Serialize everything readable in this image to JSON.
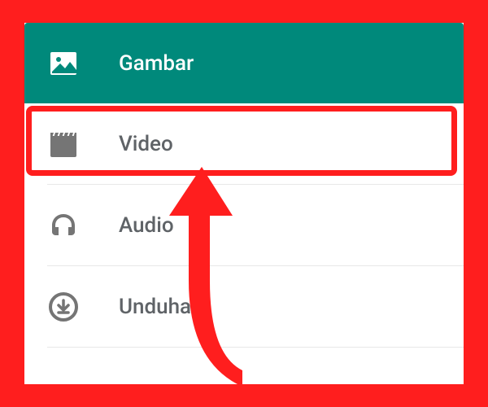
{
  "menu": {
    "items": [
      {
        "id": "gambar",
        "label": "Gambar",
        "icon": "image-icon"
      },
      {
        "id": "video",
        "label": "Video",
        "icon": "video-icon"
      },
      {
        "id": "audio",
        "label": "Audio",
        "icon": "audio-icon"
      },
      {
        "id": "unduhan",
        "label": "Unduhan",
        "icon": "download-icon"
      }
    ]
  },
  "annotation": {
    "highlighted_item": "video",
    "arrow_color": "#ff1e1e",
    "highlight_color": "#ff1e1e"
  },
  "colors": {
    "header_bg": "#00897b",
    "background": "#ff1e1e",
    "icon_gray": "#757575",
    "text_gray": "#5f6367"
  }
}
